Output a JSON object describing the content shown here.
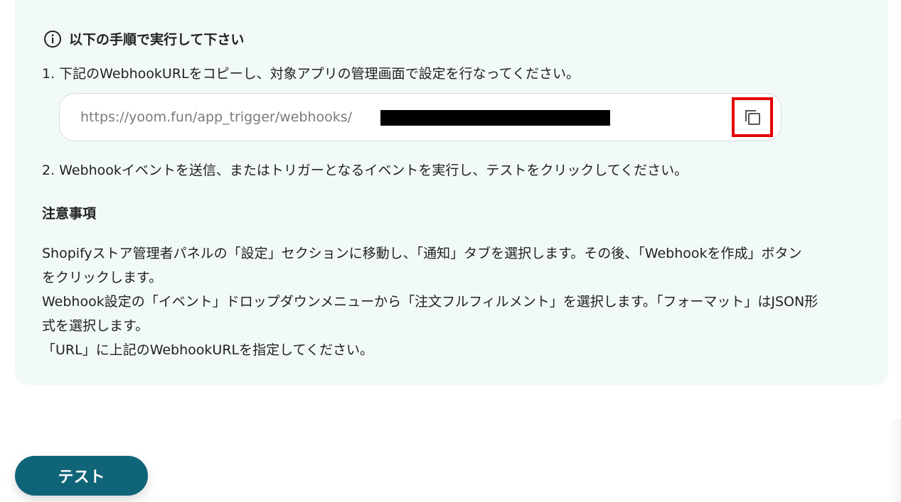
{
  "instructions": {
    "heading": "以下の手順で実行して下さい",
    "step1": "1. 下記のWebhookURLをコピーし、対象アプリの管理画面で設定を行なってください。",
    "webhook_url": "https://yoom.fun/app_trigger/webhooks/",
    "copy_icon": "copy-icon",
    "step2": "2. Webhookイベントを送信、またはトリガーとなるイベントを実行し、テストをクリックしてください。"
  },
  "notes": {
    "title": "注意事項",
    "lines": [
      "Shopifyストア管理者パネルの「設定」セクションに移動し、「通知」タブを選択します。その後、「Webhookを作成」ボタン",
      "をクリックします。",
      "Webhook設定の「イベント」ドロップダウンメニューから「注文フルフィルメント」を選択します。「フォーマット」はJSON形",
      "式を選択します。",
      "「URL」に上記のWebhookURLを指定してください。"
    ]
  },
  "actions": {
    "test_label": "テスト"
  },
  "colors": {
    "panel_bg": "#f2f9f9",
    "primary_button": "#0f6478",
    "highlight": "#e30000"
  }
}
